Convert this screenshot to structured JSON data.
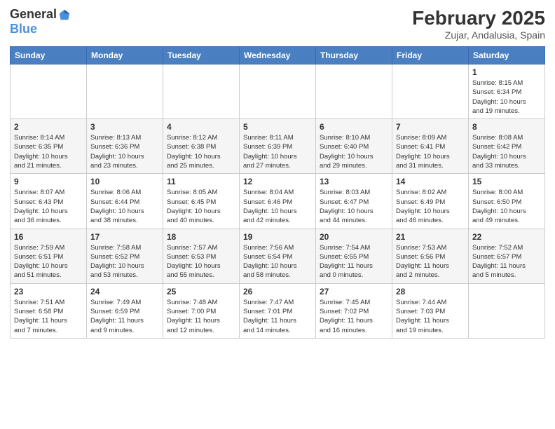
{
  "header": {
    "logo_general": "General",
    "logo_blue": "Blue",
    "month_year": "February 2025",
    "location": "Zujar, Andalusia, Spain"
  },
  "weekdays": [
    "Sunday",
    "Monday",
    "Tuesday",
    "Wednesday",
    "Thursday",
    "Friday",
    "Saturday"
  ],
  "weeks": [
    [
      {
        "day": "",
        "info": ""
      },
      {
        "day": "",
        "info": ""
      },
      {
        "day": "",
        "info": ""
      },
      {
        "day": "",
        "info": ""
      },
      {
        "day": "",
        "info": ""
      },
      {
        "day": "",
        "info": ""
      },
      {
        "day": "1",
        "info": "Sunrise: 8:15 AM\nSunset: 6:34 PM\nDaylight: 10 hours\nand 19 minutes."
      }
    ],
    [
      {
        "day": "2",
        "info": "Sunrise: 8:14 AM\nSunset: 6:35 PM\nDaylight: 10 hours\nand 21 minutes."
      },
      {
        "day": "3",
        "info": "Sunrise: 8:13 AM\nSunset: 6:36 PM\nDaylight: 10 hours\nand 23 minutes."
      },
      {
        "day": "4",
        "info": "Sunrise: 8:12 AM\nSunset: 6:38 PM\nDaylight: 10 hours\nand 25 minutes."
      },
      {
        "day": "5",
        "info": "Sunrise: 8:11 AM\nSunset: 6:39 PM\nDaylight: 10 hours\nand 27 minutes."
      },
      {
        "day": "6",
        "info": "Sunrise: 8:10 AM\nSunset: 6:40 PM\nDaylight: 10 hours\nand 29 minutes."
      },
      {
        "day": "7",
        "info": "Sunrise: 8:09 AM\nSunset: 6:41 PM\nDaylight: 10 hours\nand 31 minutes."
      },
      {
        "day": "8",
        "info": "Sunrise: 8:08 AM\nSunset: 6:42 PM\nDaylight: 10 hours\nand 33 minutes."
      }
    ],
    [
      {
        "day": "9",
        "info": "Sunrise: 8:07 AM\nSunset: 6:43 PM\nDaylight: 10 hours\nand 36 minutes."
      },
      {
        "day": "10",
        "info": "Sunrise: 8:06 AM\nSunset: 6:44 PM\nDaylight: 10 hours\nand 38 minutes."
      },
      {
        "day": "11",
        "info": "Sunrise: 8:05 AM\nSunset: 6:45 PM\nDaylight: 10 hours\nand 40 minutes."
      },
      {
        "day": "12",
        "info": "Sunrise: 8:04 AM\nSunset: 6:46 PM\nDaylight: 10 hours\nand 42 minutes."
      },
      {
        "day": "13",
        "info": "Sunrise: 8:03 AM\nSunset: 6:47 PM\nDaylight: 10 hours\nand 44 minutes."
      },
      {
        "day": "14",
        "info": "Sunrise: 8:02 AM\nSunset: 6:49 PM\nDaylight: 10 hours\nand 46 minutes."
      },
      {
        "day": "15",
        "info": "Sunrise: 8:00 AM\nSunset: 6:50 PM\nDaylight: 10 hours\nand 49 minutes."
      }
    ],
    [
      {
        "day": "16",
        "info": "Sunrise: 7:59 AM\nSunset: 6:51 PM\nDaylight: 10 hours\nand 51 minutes."
      },
      {
        "day": "17",
        "info": "Sunrise: 7:58 AM\nSunset: 6:52 PM\nDaylight: 10 hours\nand 53 minutes."
      },
      {
        "day": "18",
        "info": "Sunrise: 7:57 AM\nSunset: 6:53 PM\nDaylight: 10 hours\nand 55 minutes."
      },
      {
        "day": "19",
        "info": "Sunrise: 7:56 AM\nSunset: 6:54 PM\nDaylight: 10 hours\nand 58 minutes."
      },
      {
        "day": "20",
        "info": "Sunrise: 7:54 AM\nSunset: 6:55 PM\nDaylight: 11 hours\nand 0 minutes."
      },
      {
        "day": "21",
        "info": "Sunrise: 7:53 AM\nSunset: 6:56 PM\nDaylight: 11 hours\nand 2 minutes."
      },
      {
        "day": "22",
        "info": "Sunrise: 7:52 AM\nSunset: 6:57 PM\nDaylight: 11 hours\nand 5 minutes."
      }
    ],
    [
      {
        "day": "23",
        "info": "Sunrise: 7:51 AM\nSunset: 6:58 PM\nDaylight: 11 hours\nand 7 minutes."
      },
      {
        "day": "24",
        "info": "Sunrise: 7:49 AM\nSunset: 6:59 PM\nDaylight: 11 hours\nand 9 minutes."
      },
      {
        "day": "25",
        "info": "Sunrise: 7:48 AM\nSunset: 7:00 PM\nDaylight: 11 hours\nand 12 minutes."
      },
      {
        "day": "26",
        "info": "Sunrise: 7:47 AM\nSunset: 7:01 PM\nDaylight: 11 hours\nand 14 minutes."
      },
      {
        "day": "27",
        "info": "Sunrise: 7:45 AM\nSunset: 7:02 PM\nDaylight: 11 hours\nand 16 minutes."
      },
      {
        "day": "28",
        "info": "Sunrise: 7:44 AM\nSunset: 7:03 PM\nDaylight: 11 hours\nand 19 minutes."
      },
      {
        "day": "",
        "info": ""
      }
    ]
  ]
}
